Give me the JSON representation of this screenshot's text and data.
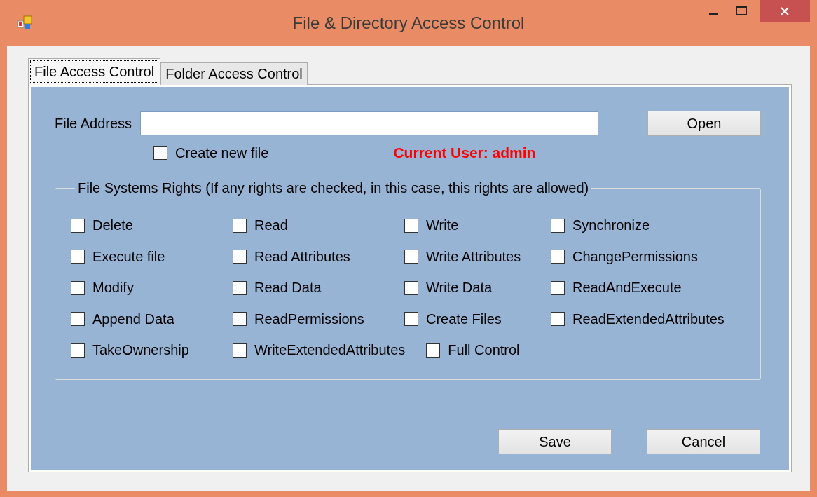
{
  "window": {
    "title": "File & Directory Access Control"
  },
  "tabs": [
    {
      "label": "File Access Control",
      "selected": true
    },
    {
      "label": "Folder Access Control",
      "selected": false
    }
  ],
  "file_address": {
    "label": "File Address"
  },
  "open_button": "Open",
  "create_new_file": {
    "label": "Create new file",
    "checked": false
  },
  "current_user": "Current User: admin",
  "rights_group": {
    "title": "File Systems Rights (If any rights are checked, in this case, this rights are allowed)",
    "rows": [
      [
        {
          "label": "Delete",
          "checked": false
        },
        {
          "label": "Read",
          "checked": false
        },
        {
          "label": "Write",
          "checked": false
        },
        {
          "label": "Synchronize",
          "checked": false
        }
      ],
      [
        {
          "label": "Execute file",
          "checked": false
        },
        {
          "label": "Read Attributes",
          "checked": false
        },
        {
          "label": "Write Attributes",
          "checked": false
        },
        {
          "label": "ChangePermissions",
          "checked": false
        }
      ],
      [
        {
          "label": "Modify",
          "checked": false
        },
        {
          "label": "Read Data",
          "checked": false
        },
        {
          "label": "Write Data",
          "checked": false
        },
        {
          "label": "ReadAndExecute",
          "checked": false
        }
      ],
      [
        {
          "label": "Append Data",
          "checked": false
        },
        {
          "label": "ReadPermissions",
          "checked": false
        },
        {
          "label": "Create Files",
          "checked": false
        },
        {
          "label": "ReadExtendedAttributes",
          "checked": false
        }
      ],
      [
        {
          "label": "TakeOwnership",
          "checked": false
        },
        {
          "label": "WriteExtendedAttributes",
          "checked": false
        },
        {
          "label": "Full Control",
          "checked": false
        }
      ]
    ]
  },
  "buttons": [
    "Save",
    "Cancel"
  ]
}
